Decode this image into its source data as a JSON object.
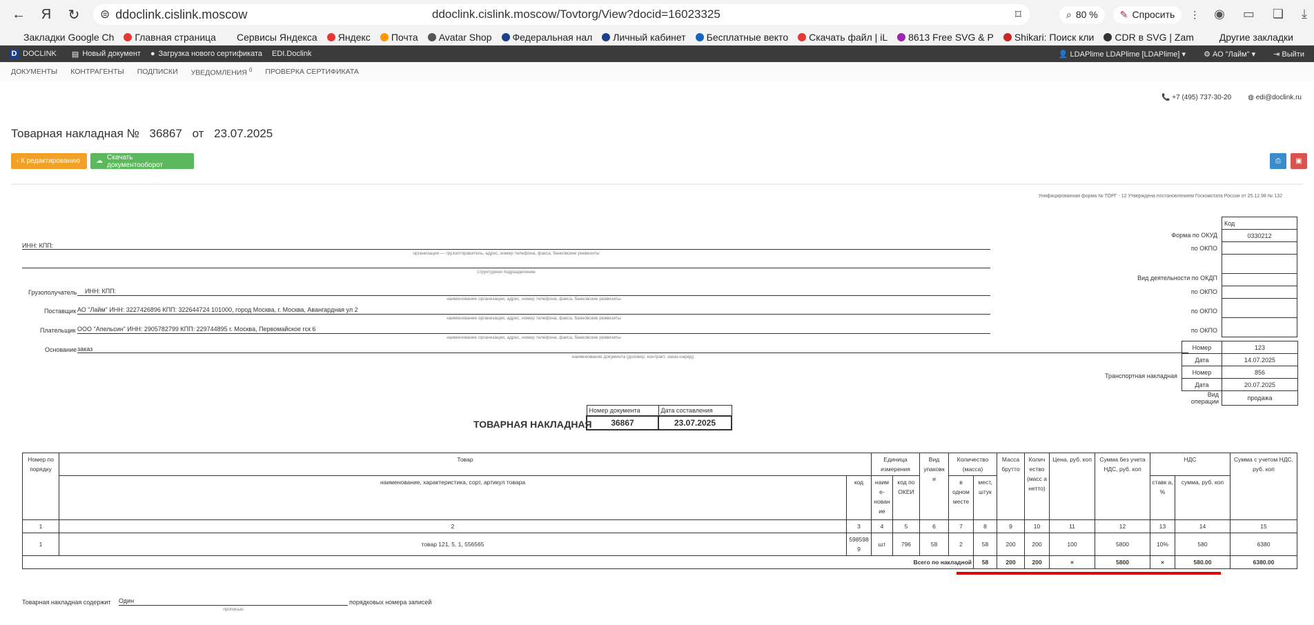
{
  "browser": {
    "domain": "ddoclink.cislink.moscow",
    "url": "ddoclink.cislink.moscow/Tovtorg/View?docid=16023325",
    "zoom": "80 %",
    "ask": "Спросить"
  },
  "bookmarks": [
    {
      "label": "Закладки Google Ch",
      "color": "#f3f3f3"
    },
    {
      "label": "Главная страница",
      "color": "#e53935"
    },
    {
      "label": "Сервисы Яндекса",
      "color": "#f3f3f3"
    },
    {
      "label": "Яндекс",
      "color": "#e53935"
    },
    {
      "label": "Почта",
      "color": "#ff9800"
    },
    {
      "label": "Avatar Shop",
      "color": "#555555"
    },
    {
      "label": "Федеральная нал",
      "color": "#1e3f8a"
    },
    {
      "label": "Личный кабинет",
      "color": "#1e3f8a"
    },
    {
      "label": "Бесплатные векто",
      "color": "#1565c0"
    },
    {
      "label": "Скачать файл | iL",
      "color": "#e53935"
    },
    {
      "label": "8613 Free SVG & P",
      "color": "#9c27b0"
    },
    {
      "label": "Shikari: Поиск кли",
      "color": "#c62828"
    },
    {
      "label": "CDR в SVG | Zam",
      "color": "#333333"
    }
  ],
  "bookmarks_other": "Другие закладки",
  "app": {
    "logo": "DOCLINK",
    "new_doc": "Новый документ",
    "upload_cert": "Загрузка нового сертификата",
    "edi": "EDI.Doclink",
    "user": "LDAPlime LDAPlime [LDAPlime]",
    "org": "АО \"Лайм\"",
    "logout": "Выйти"
  },
  "menu": {
    "documents": "ДОКУМЕНТЫ",
    "contractors": "КОНТРАГЕНТЫ",
    "signatures": "ПОДПИСКИ",
    "notifications": "УВЕДОМЛЕНИЯ",
    "notif_count": "0",
    "cert_check": "ПРОВЕРКА СЕРТИФИКАТА"
  },
  "contacts": {
    "phone": "+7 (495) 737-30-20",
    "email": "edi@doclink.ru"
  },
  "title": {
    "prefix": "Товарная накладная №",
    "number": "36867",
    "from": "от",
    "date": "23.07.2025"
  },
  "buttons": {
    "edit": "‹ К редактированию",
    "download": "Скачать документооборот"
  },
  "form": {
    "unified": "Унифицированная форма № ТОРГ - 12 Утверждена постановлением Госкомстата России от 25.12.98 № 132",
    "kod": "Код",
    "okud_label": "Форма по ОКУД",
    "okud": "0330212",
    "okpo_label": "по ОКПО",
    "inn_kpp": "ИНН:  КПП:",
    "org_sub": "организация — грузоотправитель, адрес, номер телефона, факса, банковские реквизиты",
    "struct_sub": "структурное подразделение",
    "okdp_label": "Вид деятельности по ОКДП",
    "consignee_label": "Грузополучатель",
    "consignee": "ИНН:  КПП:",
    "name_sub": "наименование организации, адрес, номер телефона, факса, банковские реквизиты",
    "supplier_label": "Поставщик",
    "supplier": "АО \"Лайм\" ИНН: 3227426896 КПП: 322644724 101000, город Москва, г. Москва, Авангардная ул 2",
    "payer_label": "Плательщик",
    "payer": "ООО \"Апельсин\"     ИНН: 2905782799 КПП: 229744895 г. Москва, Первомайское гск 6",
    "basis_label": "Основание",
    "basis": "заказ",
    "basis_sub": "наименование документа (договор, контракт, заказ-наряд)",
    "nomer_label": "Номер",
    "basis_num": "123",
    "date_label": "Дата",
    "basis_date": "14.07.2025",
    "transport_label": "Транспортная накладная",
    "transport_num": "856",
    "transport_date": "20.07.2025",
    "op_label": "Вид операции",
    "op": "продажа"
  },
  "docbox": {
    "title": "ТОВАРНАЯ НАКЛАДНАЯ",
    "num_label": "Номер документа",
    "date_label": "Дата составления",
    "num": "36867",
    "date": "23.07.2025"
  },
  "table": {
    "h_num": "Номер по порядку",
    "h_goods": "Товар",
    "h_goods_sub": "наименование, характеристика, сорт, артикул товара",
    "h_code": "код",
    "h_unit": "Единица измерения",
    "h_unit_name": "наим е- нован ие",
    "h_unit_okei": "код по ОКЕИ",
    "h_pack": "Вид упаковк и",
    "h_qty": "Количество (масса)",
    "h_qty_one": "в одном месте",
    "h_qty_places": "мест, штук",
    "h_gross": "Масса брутто",
    "h_net": "Колич ество (масс а нетто)",
    "h_price": "Цена, руб. коп",
    "h_sum_novat": "Сумма без учета НДС, руб. коп",
    "h_vat": "НДС",
    "h_vat_rate": "ставк а, %",
    "h_vat_sum": "сумма, руб. коп",
    "h_sum_vat": "Сумма с учетом НДС, руб. коп",
    "col_nums": [
      "1",
      "2",
      "3",
      "4",
      "5",
      "6",
      "7",
      "8",
      "9",
      "10",
      "11",
      "12",
      "13",
      "14",
      "15"
    ],
    "row": [
      "1",
      "товар 121, 5, 1, 556565",
      "598598 9",
      "шт",
      "796",
      "58",
      "2",
      "58",
      "200",
      "200",
      "100",
      "5800",
      "10%",
      "580",
      "6380"
    ],
    "total_label": "Всего по накладной",
    "totals": [
      "58",
      "200",
      "200",
      "×",
      "5800",
      "×",
      "580.00",
      "6380.00"
    ]
  },
  "footer": {
    "label": "Товарная накладная содержит",
    "value": "Один",
    "sub": "прописью",
    "tail": "порядковых номера записей"
  }
}
